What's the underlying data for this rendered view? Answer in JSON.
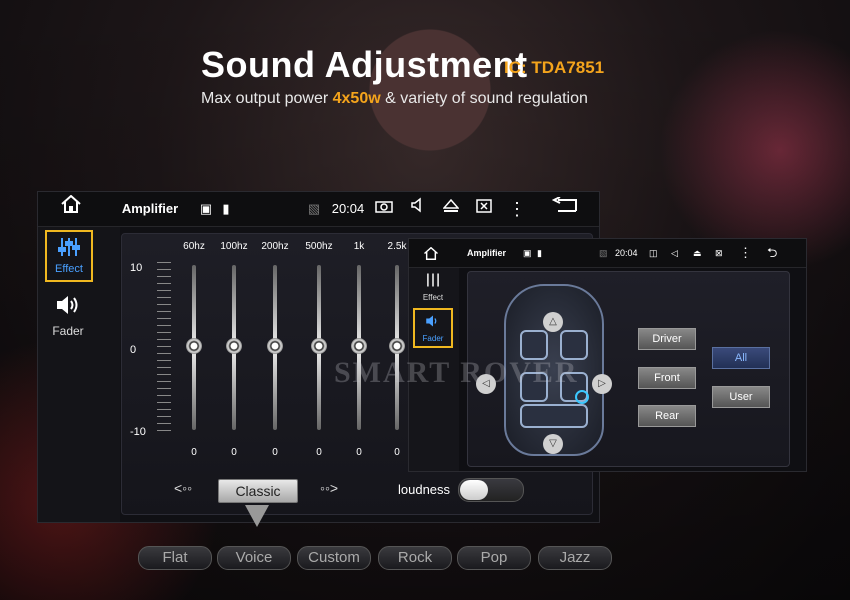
{
  "header": {
    "title": "Sound Adjustment",
    "ic_label": "IC: TDA7851",
    "subtitle_pre": "Max output power ",
    "subtitle_highlight": "4x50w",
    "subtitle_post": " & variety of sound regulation"
  },
  "main_unit": {
    "app_title": "Amplifier",
    "time": "20:04",
    "sidebar": [
      {
        "label": "Effect",
        "active": true
      },
      {
        "label": "Fader",
        "active": false
      }
    ],
    "eq": {
      "y_labels": [
        "10",
        "0",
        "-10"
      ],
      "bands": [
        {
          "freq": "60hz",
          "value": "0"
        },
        {
          "freq": "100hz",
          "value": "0"
        },
        {
          "freq": "200hz",
          "value": "0"
        },
        {
          "freq": "500hz",
          "value": "0"
        },
        {
          "freq": "1k",
          "value": "0"
        },
        {
          "freq": "2.5k",
          "value": "0"
        }
      ],
      "preset": "Classic",
      "loudness_label": "loudness",
      "loudness_on": false
    }
  },
  "fader_unit": {
    "app_title": "Amplifier",
    "time": "20:04",
    "sidebar": [
      {
        "label": "Effect",
        "active": false
      },
      {
        "label": "Fader",
        "active": true
      }
    ],
    "buttons_left": [
      "Driver",
      "Front",
      "Rear"
    ],
    "buttons_right": [
      {
        "label": "All",
        "selected": true
      },
      {
        "label": "User",
        "selected": false
      }
    ]
  },
  "presets": [
    "Flat",
    "Voice",
    "Custom",
    "Rock",
    "Pop",
    "Jazz"
  ],
  "watermark": "SMART ROVER",
  "colors": {
    "accent": "#f4a41c",
    "active_blue": "#4aa0ff",
    "highlight_border": "#f0b820"
  }
}
